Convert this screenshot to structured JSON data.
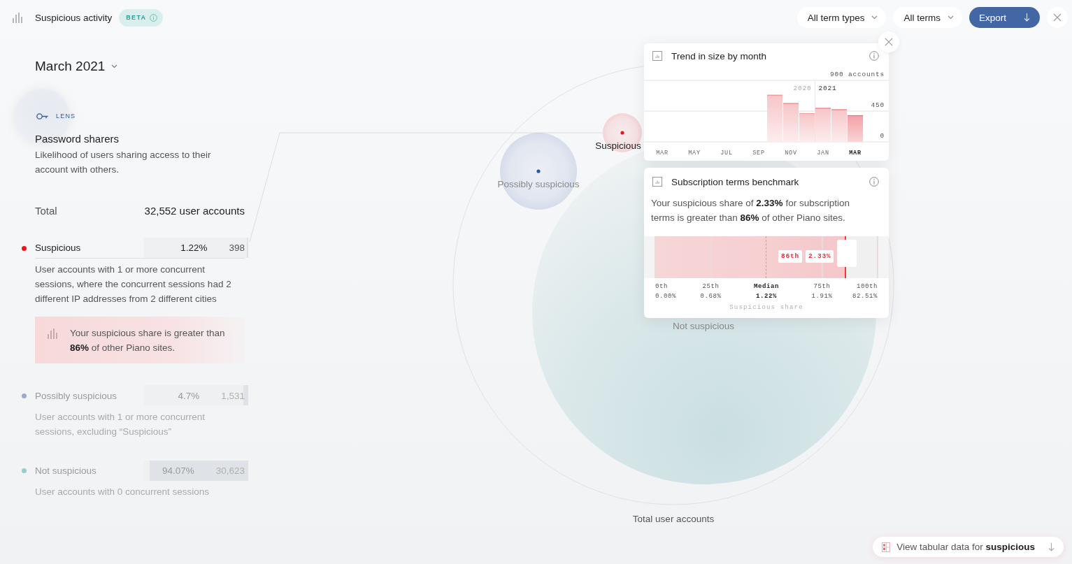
{
  "header": {
    "title": "Suspicious activity",
    "badge": "BETA"
  },
  "filters": [
    {
      "label": "All term types"
    },
    {
      "label": "All terms"
    }
  ],
  "export_button": {
    "label": "Export"
  },
  "period": {
    "label": "March 2021"
  },
  "lens": {
    "tag": "LENS",
    "title": "Password sharers",
    "description": "Likelihood of users sharing access to their account with others."
  },
  "total": {
    "label": "Total",
    "value": "32,552 user accounts"
  },
  "segments": [
    {
      "label": "Suspicious",
      "share": "1.22%",
      "count": "398",
      "level": 0.0122,
      "color": "#f0141e",
      "selected": true,
      "description": "User accounts with 1 or more concurrent sessions, where the concurrent sessions had 2 different IP addresses from 2 different cities",
      "note": "Your suspicious share is greater than **86%** of other Piano sites."
    },
    {
      "label": "Possibly suspicious",
      "share": "4.7%",
      "count": "1,531",
      "level": 0.047,
      "color": "#9aabcc",
      "selected": false,
      "description": "User accounts with 1 or more concurrent sessions, excluding “Suspicious”"
    },
    {
      "label": "Not suspicious",
      "share": "94.07%",
      "count": "30,623",
      "level": 0.9407,
      "color": "#9ccbcc",
      "selected": false,
      "description": "User accounts with 0 concurrent sessions"
    }
  ],
  "bubbles": [
    {
      "kind": "outline",
      "label": "Total user accounts",
      "selected": false
    },
    {
      "kind": "disc",
      "label": "Not suspicious",
      "selected": false
    },
    {
      "kind": "dotted",
      "label": "Possibly suspicious",
      "selected": false,
      "color": "#2a55a5"
    },
    {
      "kind": "dotted",
      "label": "Suspicious",
      "selected": true,
      "color": "#e8141e"
    }
  ],
  "trend_card": {
    "title": "Trend in size by month",
    "latest_highlighted": true,
    "chart_data": {
      "type": "bar",
      "categories": [
        "MAR",
        null,
        "MAY",
        null,
        "JUL",
        null,
        "SEP",
        null,
        "NOV",
        null,
        "JAN",
        null,
        "MAR"
      ],
      "values": [
        null,
        null,
        null,
        null,
        null,
        null,
        null,
        690,
        570,
        420,
        500,
        480,
        390
      ],
      "ylim": [
        0,
        900
      ],
      "yticks": [
        {
          "value": 0,
          "label": "0"
        },
        {
          "value": 450,
          "label": "450"
        },
        {
          "value": 900,
          "label": "900 accounts"
        }
      ],
      "annotations": [
        "2020",
        "2021"
      ]
    }
  },
  "benchmark_card": {
    "title": "Subscription terms benchmark",
    "summary": "Your suspicious share of **2.33%** for subscription terms is greater than **86%** of other Piano sites.",
    "percentiles": [
      {
        "label": "0th",
        "value": "0.00%",
        "kind": "percentile"
      },
      {
        "label": "25th",
        "value": "0.68%",
        "kind": "percentile"
      },
      {
        "label": "Median",
        "value": "1.22%",
        "kind": "median"
      },
      {
        "label": "75th",
        "value": "1.91%",
        "kind": "percentile"
      },
      {
        "label": "100th",
        "value": "82.51%",
        "kind": "percentile"
      }
    ],
    "marker": {
      "level": 0.86,
      "rank": "86th",
      "value": "2.33%"
    },
    "axis_label": "Suspicious share"
  },
  "table_link": {
    "text": "View tabular data for **suspicious**"
  }
}
